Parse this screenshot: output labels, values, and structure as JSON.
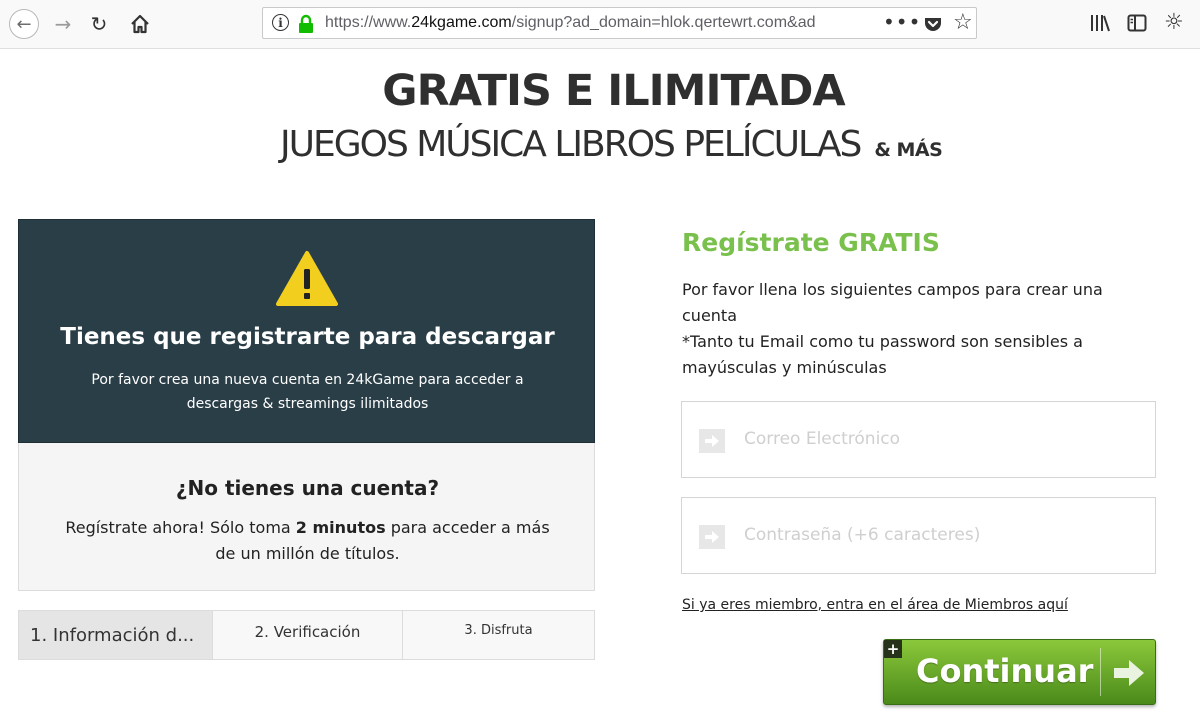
{
  "browser": {
    "url_prefix": "https://www.",
    "url_domain": "24kgame.com",
    "url_rest": "/signup?ad_domain=hlok.qertewrt.com&ad",
    "more_label": "•••"
  },
  "hero": {
    "headline": "GRATIS E ILIMITADA",
    "subhead": "JUEGOS MÚSICA LIBROS PELÍCULAS",
    "subhead_extra": "& MÁS"
  },
  "notice": {
    "title": "Tienes que registrarte para descargar",
    "description": "Por favor crea una nueva cuenta en 24kGame para acceder a descargas & streamings ilimitados"
  },
  "account": {
    "title": "¿No tienes una cuenta?",
    "desc_before": "Regístrate ahora! Sólo toma ",
    "desc_bold": "2 minutos",
    "desc_after": " para acceder a más de un millón de títulos."
  },
  "steps": [
    {
      "label": "1. Información d..."
    },
    {
      "label": "2. Verificación"
    },
    {
      "label": "3. Disfruta"
    }
  ],
  "form": {
    "title": "Regístrate GRATIS",
    "line1": "Por favor llena los siguientes campos para crear una cuenta",
    "line2": "*Tanto tu Email como tu password son sensibles a mayúsculas y minúsculas",
    "email_placeholder": "Correo Electrónico",
    "password_placeholder": "Contraseña (+6 caracteres)",
    "member_link": "Si ya eres miembro, entra en el área de Miembros aquí",
    "continue_label": "Continuar",
    "plus_label": "+"
  },
  "colors": {
    "accent_green": "#79c04c",
    "panel_dark": "#2a3e47",
    "warning_yellow": "#f2cf1e"
  }
}
